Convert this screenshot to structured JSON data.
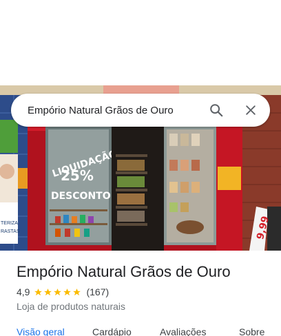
{
  "search": {
    "query": "Empório Natural Grãos de Ouro",
    "search_icon": "search-icon",
    "close_icon": "close-icon"
  },
  "photo": {
    "window_text_1": "LIQUIDAÇÃO",
    "window_text_2": "25%",
    "window_text_3": "DESCONTO",
    "side_text_1": "TERIZA",
    "side_text_2": "RASTAS",
    "price_sign": "9,99"
  },
  "place": {
    "name": "Empório Natural Grãos de Ouro",
    "rating": "4,9",
    "stars": 5,
    "reviews": "(167)",
    "category": "Loja de produtos naturais"
  },
  "tabs": [
    {
      "label": "Visão geral",
      "active": true
    },
    {
      "label": "Cardápio",
      "active": false
    },
    {
      "label": "Avaliações",
      "active": false
    },
    {
      "label": "Sobre",
      "active": false
    }
  ],
  "colors": {
    "accent": "#1a73e8",
    "star": "#fbbc04",
    "storefront_red": "#b0121e"
  }
}
